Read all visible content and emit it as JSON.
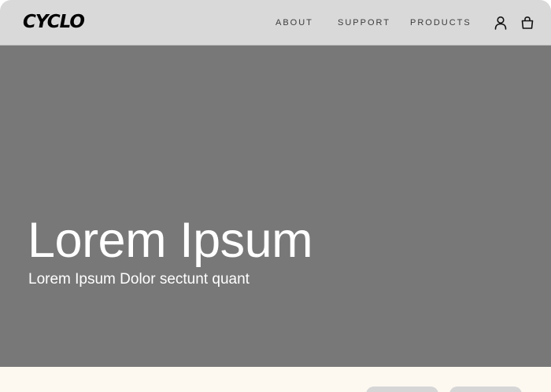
{
  "header": {
    "logo": "CYCLO",
    "nav": {
      "about": "ABOUT",
      "support": "SUPPORT",
      "products": "PRODUCTS"
    },
    "icons": {
      "account": "user-icon",
      "cart": "shopping-bag-icon"
    }
  },
  "hero": {
    "title": "Lorem Ipsum",
    "subtitle": "Lorem Ipsum Dolor sectunt quant"
  },
  "colors": {
    "header_bg": "#d9d9d9",
    "hero_bg": "#787878",
    "band_bg": "#fdf9f1",
    "pill_bg": "#d6d6d6"
  }
}
